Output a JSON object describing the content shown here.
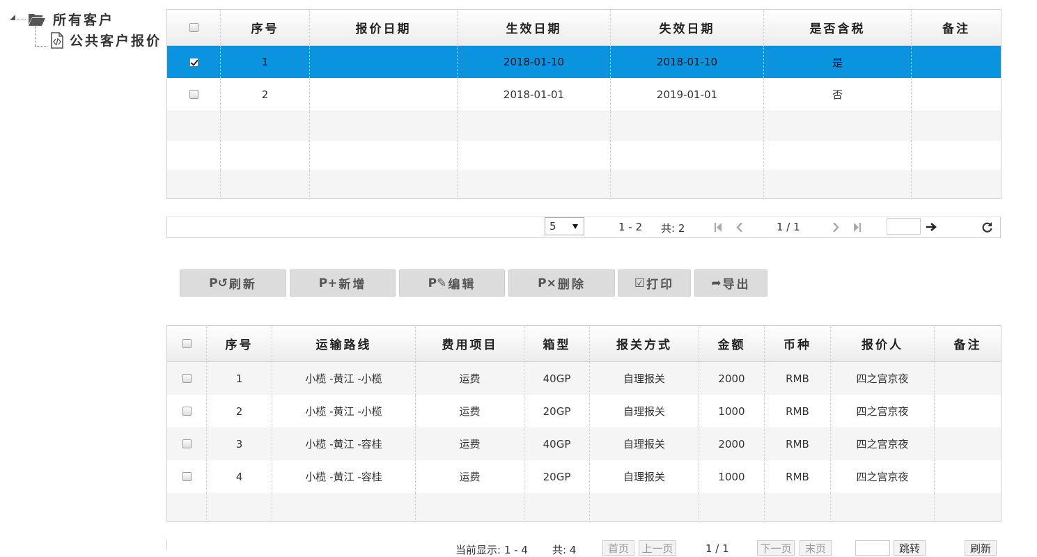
{
  "tree": {
    "root_label": "所有客户",
    "child_label": "公共客户报价"
  },
  "grid1": {
    "headers": [
      "序号",
      "报价日期",
      "生效日期",
      "失效日期",
      "是否含税",
      "备注"
    ],
    "rows": [
      {
        "checked": true,
        "seq": "1",
        "quote_date": "",
        "start_date": "2018-01-10",
        "end_date": "2018-01-10",
        "tax": "是",
        "note": ""
      },
      {
        "checked": false,
        "seq": "2",
        "quote_date": "",
        "start_date": "2018-01-01",
        "end_date": "2019-01-01",
        "tax": "否",
        "note": ""
      }
    ]
  },
  "pager1": {
    "page_size": "5",
    "range": "1 - 2",
    "total": "共: 2",
    "page": "1 / 1"
  },
  "toolbar": {
    "refresh": "刷新",
    "add": "新增",
    "edit": "编辑",
    "delete": "删除",
    "print": "打印",
    "export": "导出"
  },
  "grid2": {
    "headers": [
      "序号",
      "运输路线",
      "费用项目",
      "箱型",
      "报关方式",
      "金额",
      "币种",
      "报价人",
      "备注"
    ],
    "rows": [
      {
        "seq": "1",
        "route": "小榄 -黄江 -小榄",
        "fee": "运费",
        "box": "40GP",
        "customs": "自理报关",
        "amount": "2000",
        "currency": "RMB",
        "quoter": "四之宫京夜",
        "note": ""
      },
      {
        "seq": "2",
        "route": "小榄 -黄江 -小榄",
        "fee": "运费",
        "box": "20GP",
        "customs": "自理报关",
        "amount": "1000",
        "currency": "RMB",
        "quoter": "四之宫京夜",
        "note": ""
      },
      {
        "seq": "3",
        "route": "小榄 -黄江 -容桂",
        "fee": "运费",
        "box": "40GP",
        "customs": "自理报关",
        "amount": "2000",
        "currency": "RMB",
        "quoter": "四之宫京夜",
        "note": ""
      },
      {
        "seq": "4",
        "route": "小榄 -黄江 -容桂",
        "fee": "运费",
        "box": "20GP",
        "customs": "自理报关",
        "amount": "1000",
        "currency": "RMB",
        "quoter": "四之宫京夜",
        "note": ""
      }
    ]
  },
  "pager2": {
    "showing": "当前显示: 1 - 4",
    "total": "共: 4",
    "first": "首页",
    "prev": "上一页",
    "page": "1 / 1",
    "next": "下一页",
    "last": "末页",
    "jump": "跳转",
    "refresh": "刷新"
  }
}
